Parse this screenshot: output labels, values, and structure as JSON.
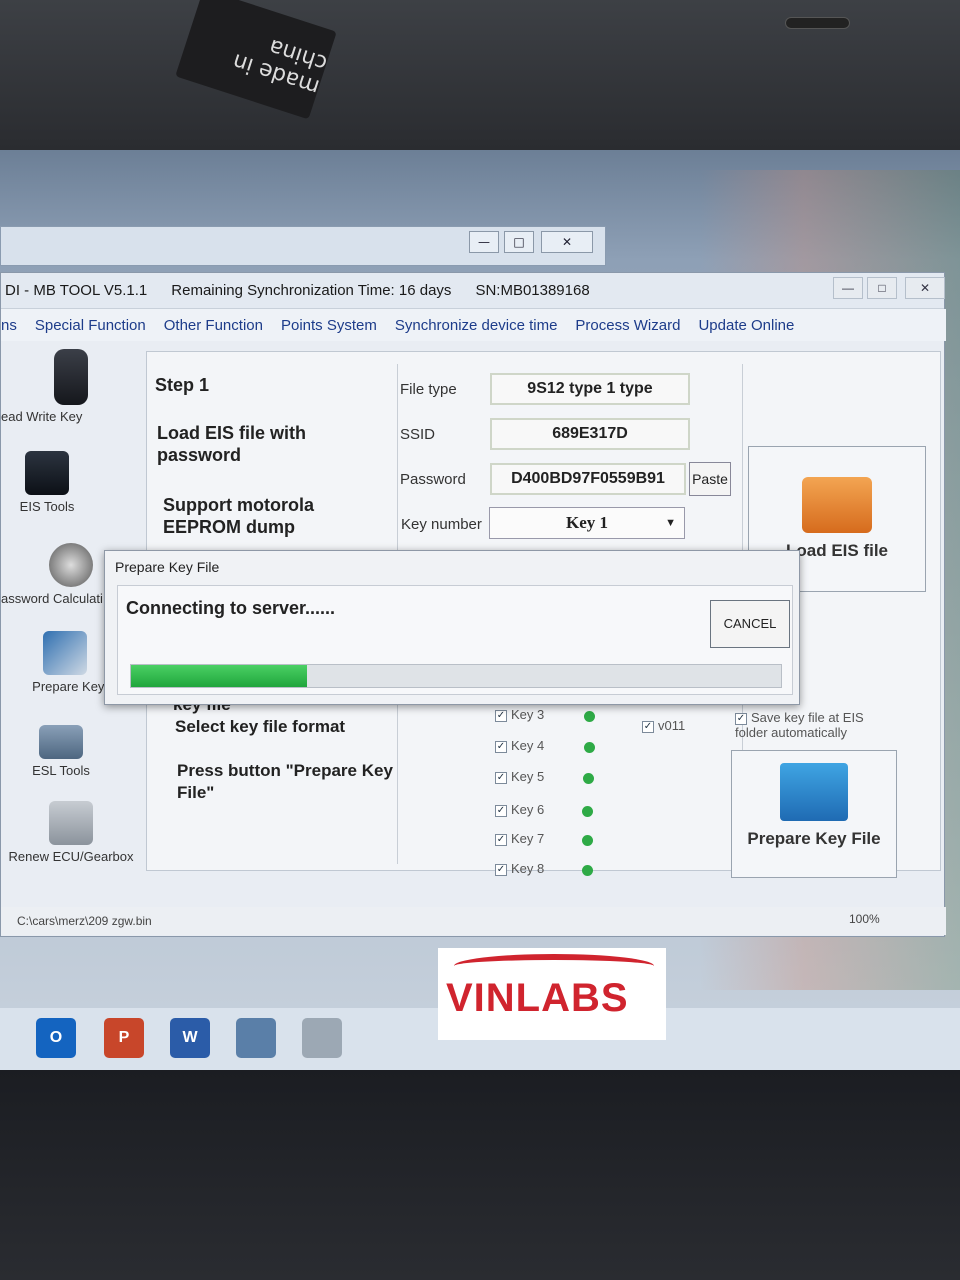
{
  "sticker": {
    "text": "made in china"
  },
  "app": {
    "title": "DI - MB TOOL V5.1.1",
    "sync": "Remaining Synchronization Time: 16 days",
    "sn": "SN:MB01389168"
  },
  "menu": [
    "ns",
    "Special Function",
    "Other Function",
    "Points System",
    "Synchronize device time",
    "Process Wizard",
    "Update Online"
  ],
  "sidebar": [
    {
      "label": "ead Write Key",
      "icon": "car-key-icon"
    },
    {
      "label": "EIS Tools",
      "icon": "eis-icon"
    },
    {
      "label": "assword Calculati",
      "icon": "gears-icon"
    },
    {
      "label": "Prepare Key File",
      "icon": "key-file-icon"
    },
    {
      "label": "ESL Tools",
      "icon": "esl-icon"
    },
    {
      "label": "Renew ECU/Gearbox",
      "icon": "ecu-icon"
    }
  ],
  "steps": {
    "step1": "Step 1",
    "load_eis": "Load EIS file with password",
    "support": "Support motorola EEPROM dump",
    "key_file": "key file",
    "select_format": "Select key file format",
    "press_button": "Press button \"Prepare Key File\""
  },
  "fields": {
    "file_type_label": "File type",
    "file_type_value": "9S12 type 1 type",
    "ssid_label": "SSID",
    "ssid_value": "689E317D",
    "password_label": "Password",
    "password_value": "D400BD97F0559B91",
    "paste_label": "Paste",
    "key_number_label": "Key number",
    "key_number_value": "Key 1"
  },
  "buttons": {
    "load_eis": "Load EIS file",
    "prepare_key": "Prepare Key File"
  },
  "keys": [
    "Key 3",
    "Key 4",
    "Key 5",
    "Key 6",
    "Key 7",
    "Key 8"
  ],
  "options": {
    "v011": "v011",
    "save_auto": "Save key file at EIS folder automatically"
  },
  "status": {
    "path": "C:\\cars\\merz\\209 zgw.bin",
    "percent": "100%"
  },
  "dialog": {
    "title": "Prepare Key File",
    "message": "Connecting to server......",
    "cancel": "CANCEL",
    "progress": 0.27
  },
  "taskbar": [
    {
      "icon": "outlook-icon",
      "letter": "O",
      "color": "#1464c0"
    },
    {
      "icon": "powerpoint-icon",
      "letter": "P",
      "color": "#c8462a"
    },
    {
      "icon": "word-icon",
      "letter": "W",
      "color": "#2b5ca8"
    }
  ],
  "watermark": {
    "text": "VINLABS"
  },
  "colors": {
    "progress": "#2eb84e",
    "link": "#1d3c8a",
    "status_dot": "#2eaa46"
  }
}
